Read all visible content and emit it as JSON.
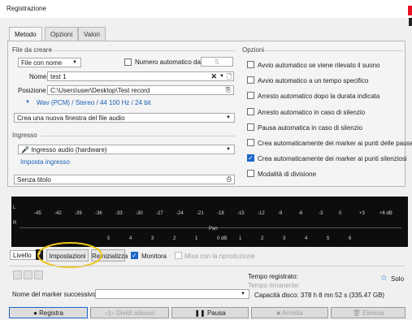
{
  "window": {
    "title": "Registrazione"
  },
  "tabs": [
    {
      "label": "Metodo"
    },
    {
      "label": "Opzioni"
    },
    {
      "label": "Valori"
    }
  ],
  "file": {
    "legend": "File da creare",
    "mode": "File con nome",
    "auto_number_label": "Numero automatico da",
    "auto_number_value": "5",
    "name_label": "Nome",
    "name_value": "test 1",
    "position_label": "Posizione",
    "position_value": "C:\\Users\\user\\Desktop\\Test record",
    "format": "Wav (PCM) / Stereo / 44 100 Hz / 24 bit",
    "window_mode": "Crea una nuova finestra del file audio"
  },
  "input": {
    "legend": "Ingresso",
    "source": "Ingresso audio (hardware)",
    "setup_link": "Imposta ingresso",
    "title_value": "Senza titolo"
  },
  "options": {
    "legend": "Opzioni",
    "items": [
      {
        "label": "Avvio automatico se viene rilevato il suono",
        "checked": false
      },
      {
        "label": "Avvio automatico a un tempo specifico",
        "checked": false
      },
      {
        "label": "Arresto automatico dopo la durata indicata",
        "checked": false
      },
      {
        "label": "Arresto automatico in caso di silenzio",
        "checked": false
      },
      {
        "label": "Pausa automatica in caso di silenzio",
        "checked": false
      },
      {
        "label": "Crea automaticamente dei marker ai punti delle pause",
        "checked": false
      },
      {
        "label": "Crea automaticamente dei marker ai punti silenziosi",
        "checked": true
      },
      {
        "label": "Modalità di divisione",
        "checked": false
      }
    ]
  },
  "meter": {
    "channel_left": "L",
    "channel_right": "R",
    "ticks_top": [
      "-45",
      "-42",
      "-39",
      "-36",
      "-33",
      "-30",
      "-27",
      "-24",
      "-21",
      "-18",
      "-15",
      "-12",
      "-9",
      "-6",
      "-3",
      "0",
      "+3",
      "+6 dB"
    ],
    "pan_label": "Pan",
    "ticks_bottom": [
      "5",
      "4",
      "3",
      "2",
      "1",
      "0 dB",
      "1",
      "2",
      "3",
      "4",
      "5",
      "6"
    ]
  },
  "controls": {
    "level": "Livello",
    "settings": "Impostazioni",
    "reset": "Reinizializza",
    "monitor": "Monitora",
    "mix": "Mixa con la riproduzione"
  },
  "status": {
    "time_recorded": "Tempo registrato:",
    "time_remaining": "Tempo rimanente:",
    "capacity": "Capacità disco: 378 h 8 mn 52 s (335.47 GB)",
    "solo": "Solo",
    "marker_label": "Nome del marker successivo"
  },
  "actions": {
    "record": "Registra",
    "split": "Dividi adesso",
    "pause": "Pausa",
    "stop": "Arresta",
    "delete": "Elimina"
  },
  "colors": {
    "accent": "#1a66c8",
    "highlight_circle": "#f0c419"
  }
}
